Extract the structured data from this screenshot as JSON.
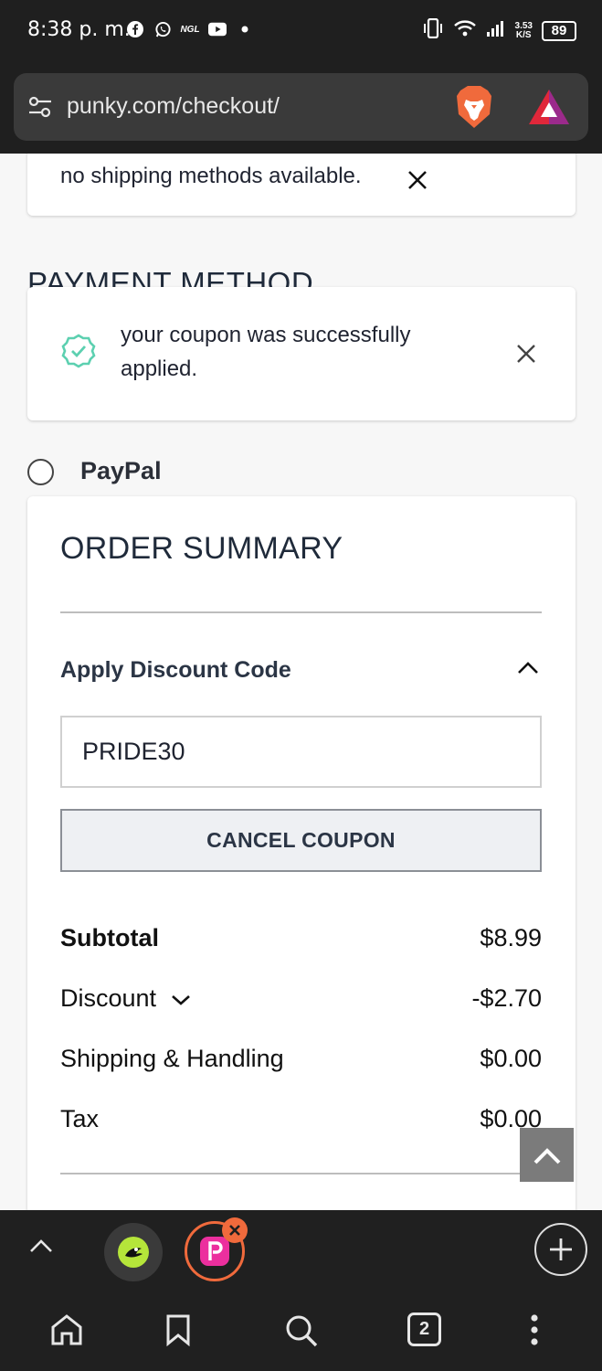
{
  "status_bar": {
    "time": "8:38 p. m.",
    "ngl_label": "NGL",
    "net_speed_value": "3.53",
    "net_speed_unit": "K/S",
    "battery": "89"
  },
  "browser": {
    "url": "punky.com/checkout/",
    "tab_count": "2"
  },
  "shipping_notice": {
    "text": "no shipping methods available."
  },
  "payment": {
    "section_title": "PAYMENT METHOD",
    "coupon_message": "your coupon was successfully applied.",
    "option_label": "PayPal"
  },
  "order_summary": {
    "title": "ORDER SUMMARY",
    "discount_heading": "Apply Discount Code",
    "coupon_code": "PRIDE30",
    "cancel_coupon_label": "CANCEL COUPON",
    "rows": [
      {
        "label": "Subtotal",
        "value": "$8.99"
      },
      {
        "label": "Discount",
        "value": "-$2.70"
      },
      {
        "label": "Shipping & Handling",
        "value": "$0.00"
      },
      {
        "label": "Tax",
        "value": "$0.00"
      }
    ]
  },
  "colors": {
    "success_check": "#5cd0b0",
    "brave_orange": "#f06a3c",
    "status_bar_bg": "#1f1f1f"
  },
  "icons": [
    "facebook-icon",
    "whatsapp-icon",
    "youtube-icon",
    "vibrate-icon",
    "wifi-icon",
    "signal-icon",
    "tune-icon",
    "brave-lion-icon",
    "bat-triangle-icon",
    "close-icon",
    "check-badge-icon",
    "chevron-up-icon",
    "chevron-down-icon",
    "home-icon",
    "bookmark-icon",
    "search-icon",
    "more-vert-icon",
    "plus-icon"
  ]
}
